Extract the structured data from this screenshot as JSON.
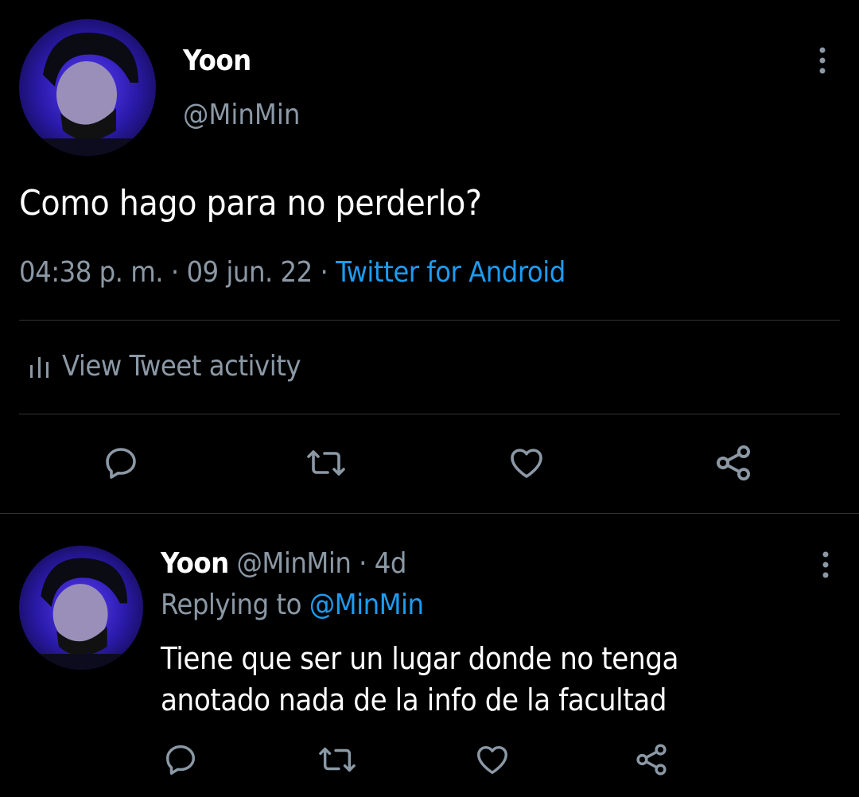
{
  "main_tweet": {
    "author_name": "Yoon",
    "author_handle": "@MinMin",
    "text": "Como hago para no perderlo?",
    "time": "04:38 p. m.",
    "sep1": " · ",
    "date": "09 jun. 22",
    "sep2": " · ",
    "source": "Twitter for Android",
    "activity_label": "View Tweet activity",
    "actions": [
      "reply-icon",
      "retweet-icon",
      "like-icon",
      "share-icon"
    ]
  },
  "reply": {
    "author_name": "Yoon",
    "author_handle": "@MinMin",
    "sep": " · ",
    "age": "4d",
    "replying_prefix": "Replying to ",
    "replying_to": "@MinMin",
    "text_line1": "Tiene que ser un lugar donde no tenga",
    "text_line2": "anotado nada de la info de la facultad",
    "actions": [
      "reply-icon",
      "retweet-icon",
      "like-icon",
      "share-icon"
    ]
  },
  "colors": {
    "background": "#000000",
    "text_primary": "#ffffff",
    "text_secondary": "#8b98a5",
    "accent": "#1d9bf0",
    "divider": "#2f3336",
    "avatar_glow": "#3b2bd9"
  }
}
